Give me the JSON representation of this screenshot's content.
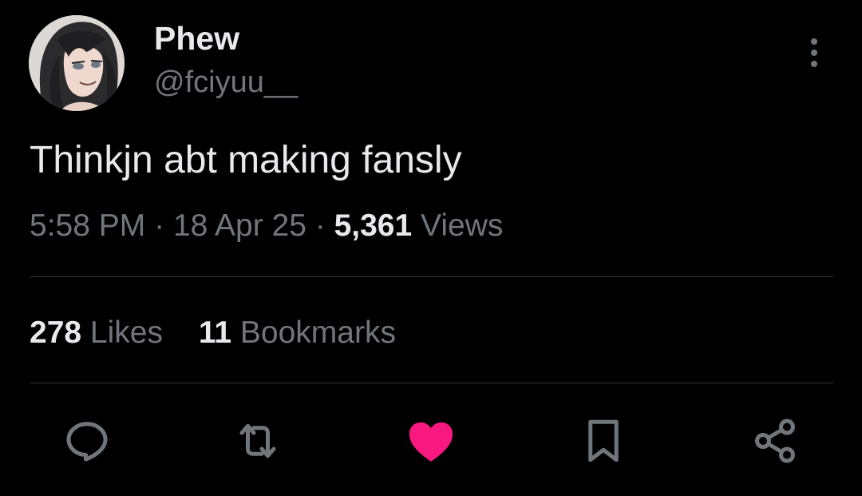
{
  "tweet": {
    "author": {
      "display_name": "Phew",
      "handle": "@fciyuu__"
    },
    "text": "Thinkjn abt making fansly",
    "meta": {
      "time": "5:58 PM",
      "separator": "·",
      "date": "18 Apr 25",
      "views_count": "5,361",
      "views_label": "Views"
    },
    "stats": {
      "likes_count": "278",
      "likes_label": "Likes",
      "bookmarks_count": "11",
      "bookmarks_label": "Bookmarks"
    },
    "actions": {
      "reply_icon": "reply-icon",
      "repost_icon": "repost-icon",
      "like_icon": "heart-filled-icon",
      "bookmark_icon": "bookmark-icon",
      "share_icon": "share-icon",
      "liked": true
    },
    "more_icon": "more-vertical-icon"
  },
  "colors": {
    "background": "#000000",
    "primary_text": "#e7e9ea",
    "secondary_text": "#71767b",
    "divider": "#2f3336",
    "like_active": "#f91880"
  }
}
